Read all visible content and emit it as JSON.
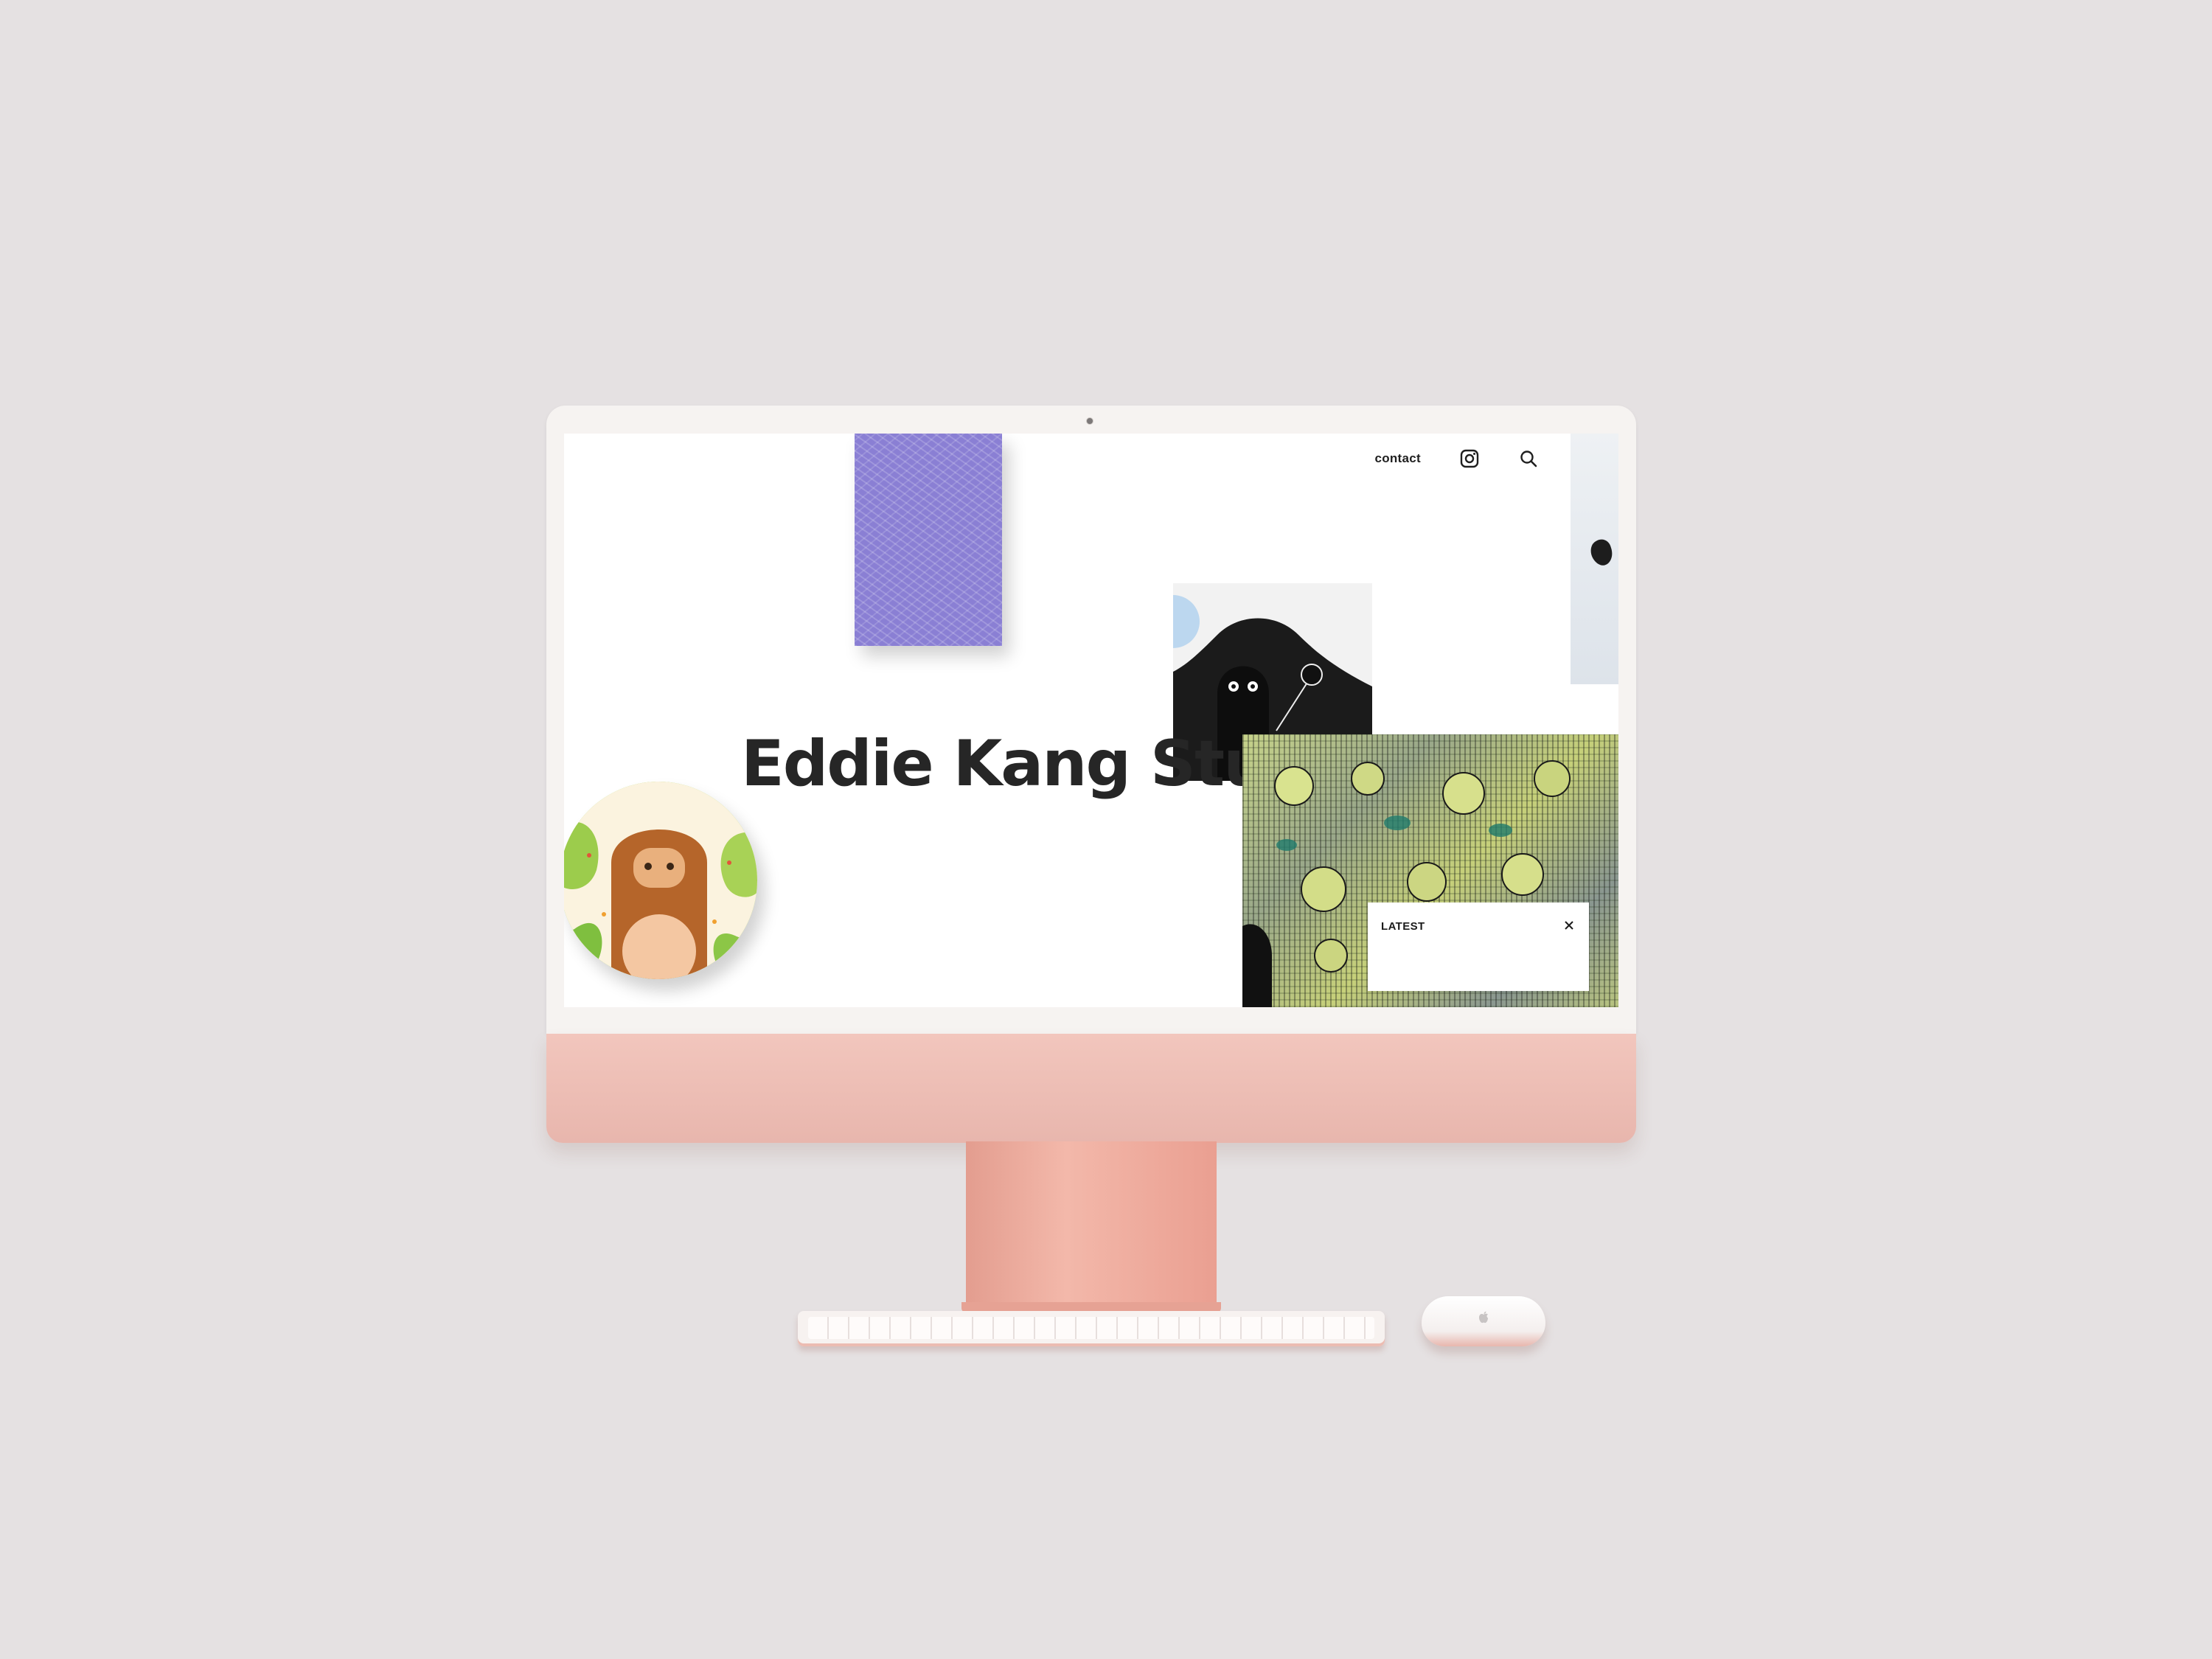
{
  "website": {
    "nav": {
      "contact_label": "contact",
      "instagram_icon": "instagram-icon",
      "search_icon": "search-icon",
      "menu_icon": "hamburger-menu-icon"
    },
    "hero": {
      "title": "Eddie Kang Studio"
    },
    "latest_panel": {
      "label": "LATEST",
      "close_icon": "close-icon"
    }
  },
  "colors": {
    "background": "#e5e1e2",
    "device_accent": "#f0bdb3",
    "title_text": "#262626",
    "purple_artwork": "#8a7fd4"
  }
}
